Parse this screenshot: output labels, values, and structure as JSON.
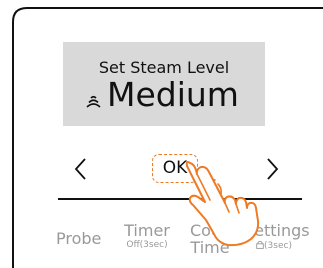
{
  "display": {
    "title": "Set Steam Level",
    "value": "Medium",
    "icon": "steam-icon"
  },
  "controls": {
    "left_icon": "chevron-left-icon",
    "ok_label": "OK",
    "right_icon": "chevron-right-icon"
  },
  "menu": {
    "probe": "Probe",
    "timer": "Timer",
    "timer_sub": "Off(3sec)",
    "cook_time_line1": "Cook",
    "cook_time_line2": "Time",
    "settings": "Settings",
    "settings_sub": "(3sec)",
    "settings_icon": "lock-icon"
  },
  "overlay": {
    "hand_icon": "hand-tap-icon"
  },
  "colors": {
    "display_bg": "#d9d9d9",
    "accent": "#f07a24",
    "text_dark": "#111111",
    "text_dim": "#999999"
  }
}
